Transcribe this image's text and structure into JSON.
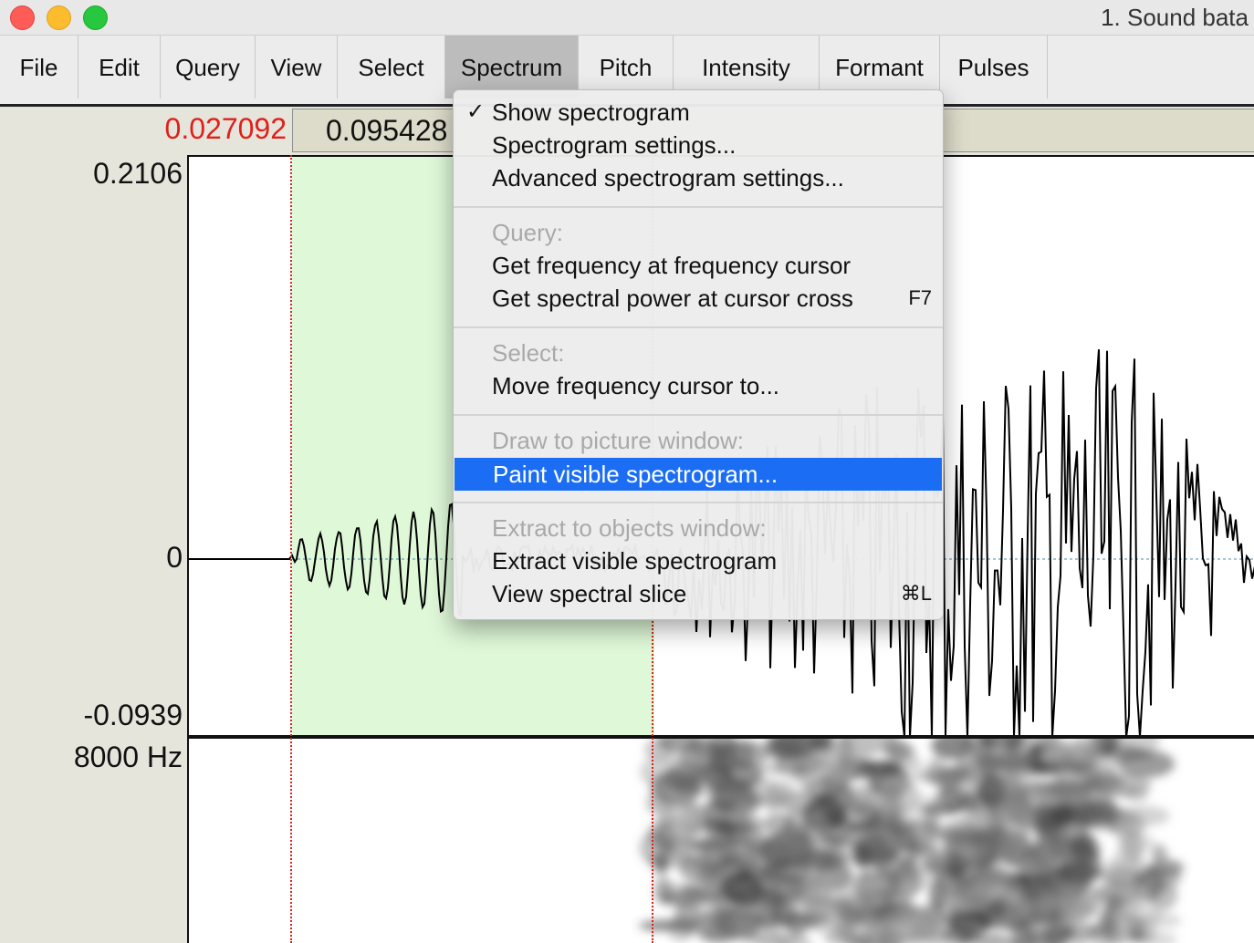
{
  "window": {
    "title": "1. Sound bata"
  },
  "menubar": {
    "items": [
      {
        "label": "File"
      },
      {
        "label": "Edit"
      },
      {
        "label": "Query"
      },
      {
        "label": "View"
      },
      {
        "label": "Select"
      },
      {
        "label": "Spectrum",
        "active": true
      },
      {
        "label": "Pitch"
      },
      {
        "label": "Intensity"
      },
      {
        "label": "Formant"
      },
      {
        "label": "Pulses"
      }
    ]
  },
  "selection": {
    "start_time": "0.027092",
    "duration": "0.095428"
  },
  "waveform": {
    "y_max": "0.2106",
    "y_zero": "0",
    "y_min": "-0.0939"
  },
  "spectrogram": {
    "max_freq": "8000 Hz"
  },
  "dropdown": {
    "sections": [
      {
        "items": [
          {
            "label": "Show spectrogram",
            "checked": true
          },
          {
            "label": "Spectrogram settings..."
          },
          {
            "label": "Advanced spectrogram settings..."
          }
        ]
      },
      {
        "header": "Query:",
        "items": [
          {
            "label": "Get frequency at frequency cursor"
          },
          {
            "label": "Get spectral power at cursor cross",
            "shortcut": "F7"
          }
        ]
      },
      {
        "header": "Select:",
        "items": [
          {
            "label": "Move frequency cursor to..."
          }
        ]
      },
      {
        "header": "Draw to picture window:",
        "items": [
          {
            "label": "Paint visible spectrogram...",
            "highlighted": true
          }
        ]
      },
      {
        "header": "Extract to objects window:",
        "items": [
          {
            "label": "Extract visible spectrogram"
          },
          {
            "label": "View spectral slice",
            "shortcut": "⌘L"
          }
        ]
      }
    ]
  },
  "colors": {
    "selection_fill": "#dff8d8",
    "cursor_red": "#e0201b",
    "highlight_blue": "#1b6ef3",
    "active_menu": "#bcbcbc"
  }
}
